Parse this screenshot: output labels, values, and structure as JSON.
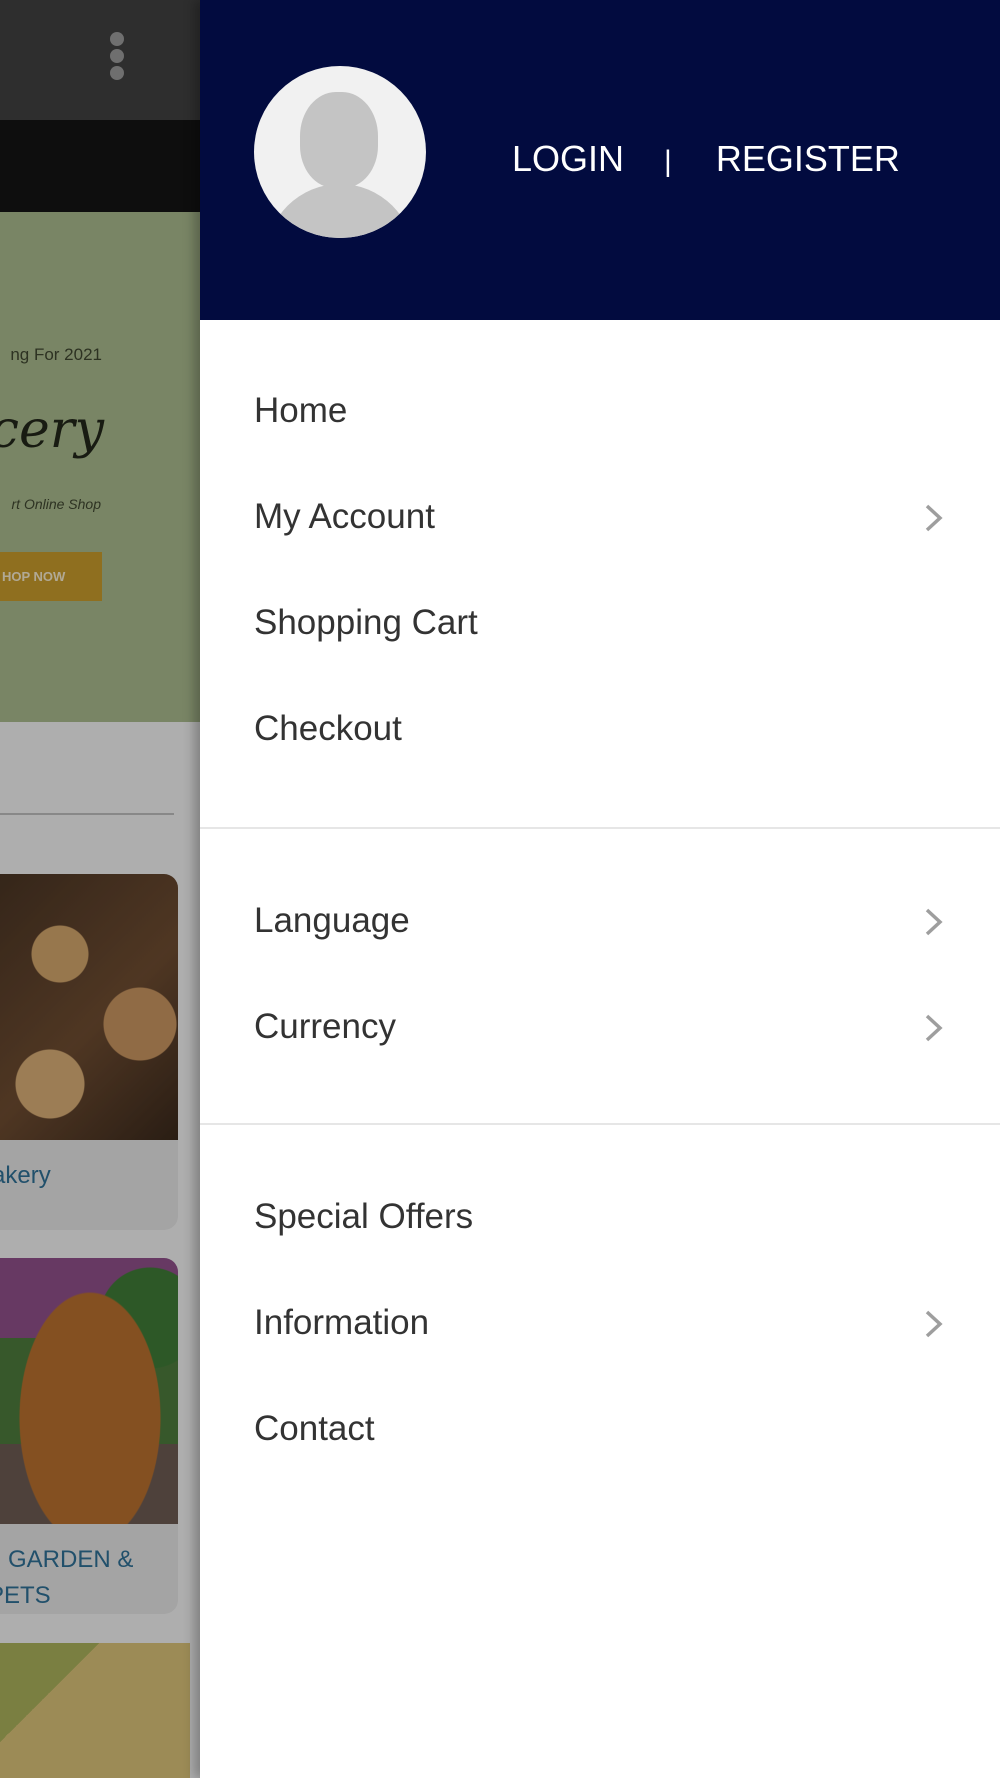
{
  "background_page": {
    "banner": {
      "tagline_fragment": "ng For 2021",
      "title_fragment": "cery",
      "subtitle_fragment": "rt Online Shop",
      "button_fragment": "HOP NOW"
    },
    "categories": [
      {
        "label": "akery"
      },
      {
        "label_line1": "I, GARDEN &",
        "label_line2": "PETS"
      }
    ]
  },
  "drawer": {
    "auth": {
      "login_label": "LOGIN",
      "separator": "|",
      "register_label": "REGISTER"
    },
    "menu_groups": [
      {
        "items": [
          {
            "label": "Home",
            "has_submenu": false
          },
          {
            "label": "My Account",
            "has_submenu": true
          },
          {
            "label": "Shopping Cart",
            "has_submenu": false
          },
          {
            "label": "Checkout",
            "has_submenu": false
          }
        ]
      },
      {
        "items": [
          {
            "label": "Language",
            "has_submenu": true
          },
          {
            "label": "Currency",
            "has_submenu": true
          }
        ]
      },
      {
        "items": [
          {
            "label": "Special Offers",
            "has_submenu": false
          },
          {
            "label": "Information",
            "has_submenu": true
          },
          {
            "label": "Contact",
            "has_submenu": false
          }
        ]
      }
    ]
  },
  "colors": {
    "drawer_header": "#020b3f",
    "menu_text": "#333333",
    "chevron": "#9e9e9e",
    "category_link": "#2f6f95"
  },
  "icons": {
    "overflow": "kebab-menu-icon",
    "avatar": "user-avatar-placeholder-icon",
    "submenu": "chevron-right-icon"
  }
}
